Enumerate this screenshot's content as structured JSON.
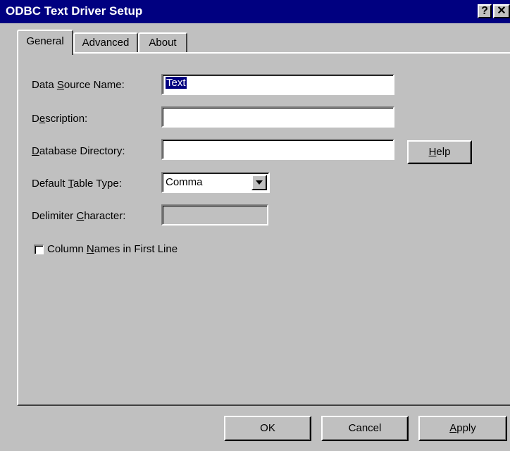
{
  "window": {
    "title": "ODBC Text Driver Setup",
    "help_glyph": "?",
    "close_glyph": "✕"
  },
  "tabs": [
    {
      "label": "General",
      "active": true
    },
    {
      "label": "Advanced",
      "active": false
    },
    {
      "label": "About",
      "active": false
    }
  ],
  "form": {
    "data_source_name": {
      "label_pre": "Data ",
      "label_key": "S",
      "label_post": "ource Name:",
      "value": "Text"
    },
    "description": {
      "label_pre": "D",
      "label_key": "e",
      "label_post": "scription:",
      "value": ""
    },
    "database_directory": {
      "label_pre": "",
      "label_key": "D",
      "label_post": "atabase Directory:",
      "value": ""
    },
    "default_table_type": {
      "label_pre": "Default ",
      "label_key": "T",
      "label_post": "able Type:",
      "value": "Comma"
    },
    "delimiter_character": {
      "label_pre": "Delimiter ",
      "label_key": "C",
      "label_post": "haracter:",
      "value": ""
    },
    "column_names": {
      "label_pre": "Column ",
      "label_key": "N",
      "label_post": "ames in First Line",
      "checked": false
    },
    "help_button": {
      "label_key": "H",
      "label_post": "elp"
    }
  },
  "buttons": {
    "ok": {
      "label": "OK"
    },
    "cancel": {
      "label": "Cancel"
    },
    "apply": {
      "label_key": "A",
      "label_post": "pply"
    }
  }
}
